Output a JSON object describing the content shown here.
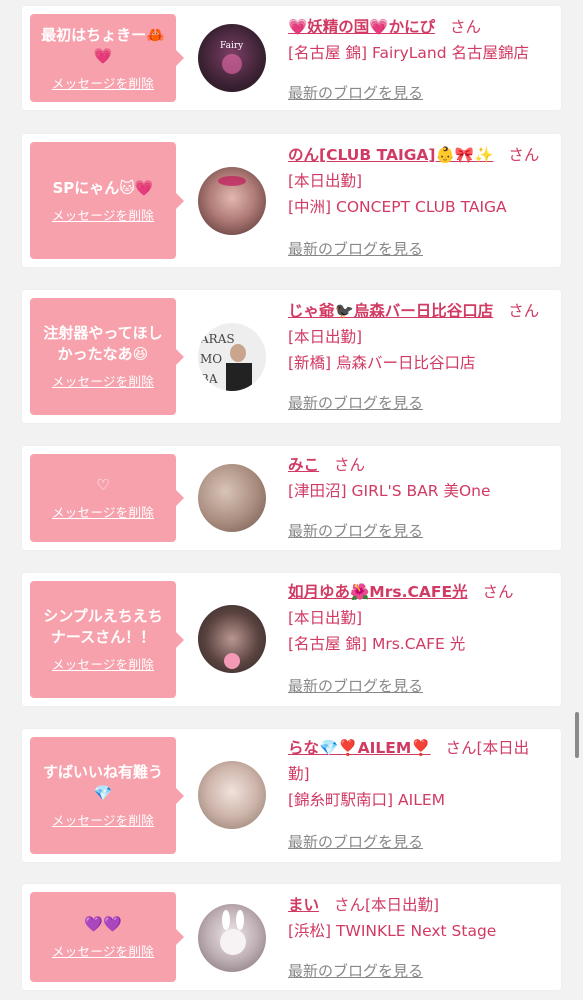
{
  "items": [
    {
      "message": "最初はちょきー🦀💗",
      "delete_label": "メッセージを削除",
      "name": "💗妖精の国💗かにぴ",
      "honorific": "さん",
      "status": "",
      "shop": "[名古屋 錦] FairyLand 名古屋錦店",
      "blog_label": "最新のブログを見る",
      "avatar_colors": [
        "#5a2b4a",
        "#1d1420"
      ]
    },
    {
      "message": "SPにゃん🐱💗",
      "delete_label": "メッセージを削除",
      "name": "のん[CLUB TAIGA]👶🎀✨",
      "honorific": "さん",
      "status": "[本日出勤]",
      "shop": "[中洲] CONCEPT CLUB TAIGA",
      "blog_label": "最新のブログを見る",
      "avatar_colors": [
        "#c98f8a",
        "#4a2a2a"
      ]
    },
    {
      "message": "注射器やってほしかったなあ😆",
      "delete_label": "メッセージを削除",
      "name": "じゃ爺🐦‍⬛烏森バー日比谷口店",
      "honorific": "さん",
      "status": "[本日出勤]",
      "shop": "[新橋] 烏森バー日比谷口店",
      "blog_label": "最新のブログを見る",
      "avatar_colors": [
        "#e8e8e8",
        "#222222"
      ]
    },
    {
      "message": "♡",
      "delete_label": "メッセージを削除",
      "name": "みこ",
      "honorific": "さん",
      "status": "",
      "shop": "[津田沼] GIRL'S BAR 美One",
      "blog_label": "最新のブログを見る",
      "avatar_colors": [
        "#c4a79a",
        "#6b5548"
      ]
    },
    {
      "message": "シンプルえちえちナースさん！！",
      "delete_label": "メッセージを削除",
      "name": "如月ゆあ🌺Mrs.CAFE光",
      "honorific": "さん",
      "status": "[本日出勤]",
      "shop": "[名古屋 錦] Mrs.CAFE 光",
      "blog_label": "最新のブログを見る",
      "avatar_colors": [
        "#3a2e2c",
        "#b08a86"
      ]
    },
    {
      "message": "すばいいね有難う💎",
      "delete_label": "メッセージを削除",
      "name": "らな💎❣️AILEM❣️",
      "honorific": "さん",
      "status": "[本日出勤]",
      "shop": "[錦糸町駅南口] AILEM",
      "blog_label": "最新のブログを見る",
      "avatar_colors": [
        "#e0cdc4",
        "#8c7468"
      ]
    },
    {
      "message": "💜💜",
      "delete_label": "メッセージを削除",
      "name": "まい",
      "honorific": "さん",
      "status": "[本日出勤]",
      "shop": "[浜松] TWINKLE Next Stage",
      "blog_label": "最新のブログを見る",
      "avatar_colors": [
        "#d8d0d4",
        "#7a6a70"
      ]
    }
  ]
}
